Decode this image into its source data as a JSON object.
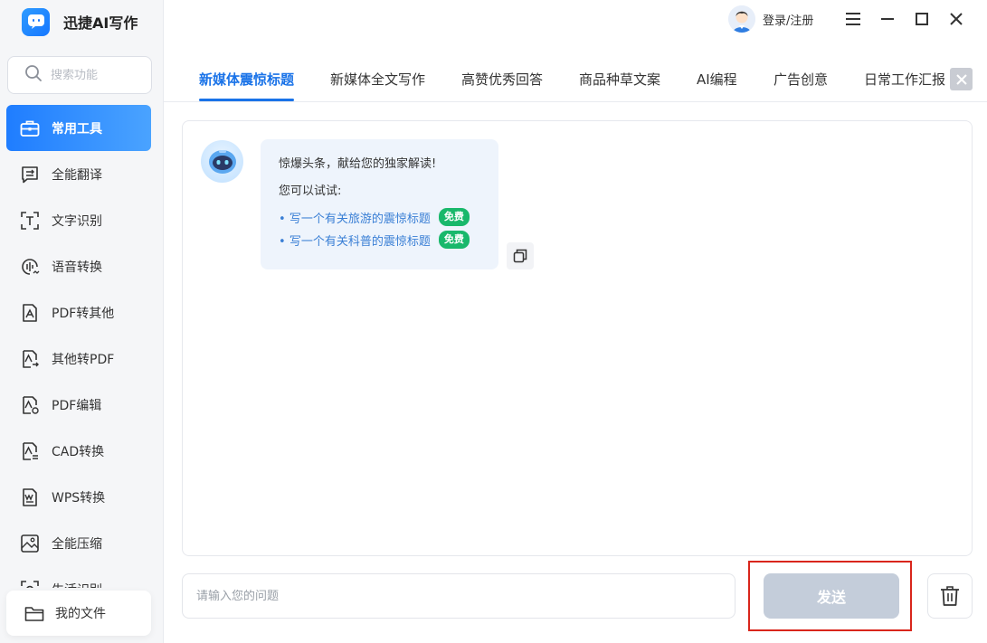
{
  "app": {
    "title": "迅捷AI写作",
    "accent": "#1a73e8"
  },
  "search": {
    "placeholder": "搜索功能",
    "icon": "search-icon"
  },
  "sidebar": {
    "items": [
      {
        "label": "常用工具",
        "icon": "toolbox-icon",
        "active": true
      },
      {
        "label": "全能翻译",
        "icon": "translate-icon"
      },
      {
        "label": "文字识别",
        "icon": "text-recognition-icon"
      },
      {
        "label": "语音转换",
        "icon": "voice-convert-icon"
      },
      {
        "label": "PDF转其他",
        "icon": "pdf-convert-icon"
      },
      {
        "label": "其他转PDF",
        "icon": "to-pdf-icon"
      },
      {
        "label": "PDF编辑",
        "icon": "pdf-edit-icon"
      },
      {
        "label": "CAD转换",
        "icon": "cad-convert-icon"
      },
      {
        "label": "WPS转换",
        "icon": "wps-convert-icon"
      },
      {
        "label": "全能压缩",
        "icon": "compress-icon"
      },
      {
        "label": "生活识别",
        "icon": "life-recognition-icon"
      }
    ],
    "my_files": "我的文件"
  },
  "header": {
    "login_label": "登录/注册"
  },
  "tabs": [
    {
      "label": "新媒体震惊标题",
      "active": true
    },
    {
      "label": "新媒体全文写作"
    },
    {
      "label": "高赞优秀回答"
    },
    {
      "label": "商品种草文案"
    },
    {
      "label": "AI编程"
    },
    {
      "label": "广告创意"
    },
    {
      "label": "日常工作汇报"
    }
  ],
  "chat": {
    "greeting": "惊爆头条，献给您的独家解读!",
    "try_label": "您可以试试:",
    "suggestions": [
      {
        "text": "写一个有关旅游的震惊标题",
        "badge": "免费"
      },
      {
        "text": "写一个有关科普的震惊标题",
        "badge": "免费"
      }
    ]
  },
  "composer": {
    "placeholder": "请输入您的问题",
    "send_label": "发送"
  }
}
